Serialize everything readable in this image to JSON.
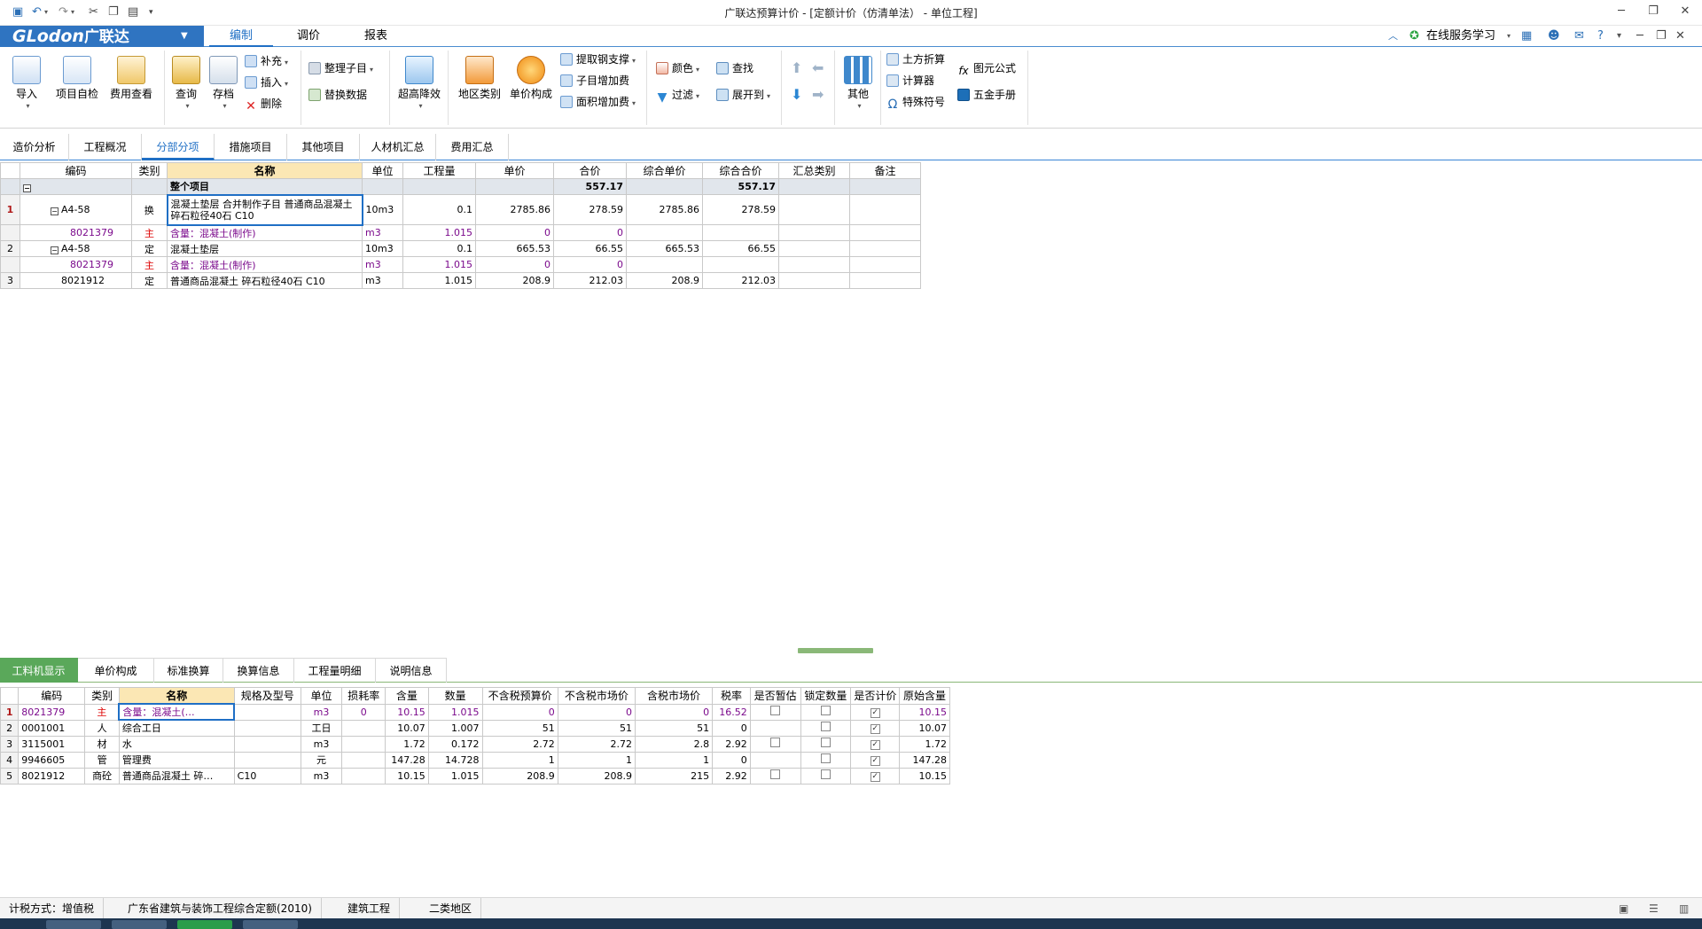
{
  "window": {
    "title": "广联达预算计价 - [定额计价（仿清单法） - 单位工程]"
  },
  "menu": {
    "logo_text": "GLodon",
    "logo_cn": "广联达",
    "tabs": [
      "编制",
      "调价",
      "报表"
    ],
    "online_learning": "在线服务学习"
  },
  "ribbon": {
    "import": "导入",
    "project_check": "项目自检",
    "fee_view": "费用查看",
    "query": "查询",
    "archive": "存档",
    "supplement": "补充",
    "insert": "插入",
    "delete": "删除",
    "organize_sub": "整理子目",
    "replace_data": "替换数据",
    "over_height": "超高降效",
    "region_type": "地区类别",
    "unit_price_comp": "单价构成",
    "extract_steel": "提取钢支撑",
    "sub_add_fee": "子目增加费",
    "area_add_fee": "面积增加费",
    "color": "颜色",
    "find": "查找",
    "filter": "过滤",
    "expand_to": "展开到",
    "other": "其他",
    "earth_convert": "土方折算",
    "calculator": "计算器",
    "special_symbol": "特殊符号",
    "formula": "图元公式",
    "hardware_manual": "五金手册"
  },
  "nav_tabs": [
    "造价分析",
    "工程概况",
    "分部分项",
    "措施项目",
    "其他项目",
    "人材机汇总",
    "费用汇总"
  ],
  "main_table": {
    "headers": [
      "编码",
      "类别",
      "名称",
      "单位",
      "工程量",
      "单价",
      "合价",
      "综合单价",
      "综合合价",
      "汇总类别",
      "备注"
    ],
    "summary": {
      "name": "整个项目",
      "total": "557.17",
      "comp_total": "557.17"
    },
    "rows": [
      {
        "num": "1",
        "code": "A4-58",
        "type": "换",
        "name": "混凝土垫层  合并制作子目 普通商品混凝土 碎石粒径40石 C10",
        "unit": "10m3",
        "qty": "0.1",
        "price": "2785.86",
        "total": "278.59",
        "comp_price": "2785.86",
        "comp_total": "278.59"
      },
      {
        "num": "",
        "code": "8021379",
        "type": "主",
        "name": "含量：混凝土(制作)",
        "unit": "m3",
        "qty": "1.015",
        "price": "0",
        "total": "0",
        "comp_price": "",
        "comp_total": ""
      },
      {
        "num": "2",
        "code": "A4-58",
        "type": "定",
        "name": "混凝土垫层",
        "unit": "10m3",
        "qty": "0.1",
        "price": "665.53",
        "total": "66.55",
        "comp_price": "665.53",
        "comp_total": "66.55"
      },
      {
        "num": "",
        "code": "8021379",
        "type": "主",
        "name": "含量：混凝土(制作)",
        "unit": "m3",
        "qty": "1.015",
        "price": "0",
        "total": "0",
        "comp_price": "",
        "comp_total": ""
      },
      {
        "num": "3",
        "code": "8021912",
        "type": "定",
        "name": "普通商品混凝土 碎石粒径40石 C10",
        "unit": "m3",
        "qty": "1.015",
        "price": "208.9",
        "total": "212.03",
        "comp_price": "208.9",
        "comp_total": "212.03"
      }
    ]
  },
  "bottom_tabs": [
    "工料机显示",
    "单价构成",
    "标准换算",
    "换算信息",
    "工程量明细",
    "说明信息"
  ],
  "bottom_table": {
    "headers": [
      "编码",
      "类别",
      "名称",
      "规格及型号",
      "单位",
      "损耗率",
      "含量",
      "数量",
      "不含税预算价",
      "不含税市场价",
      "含税市场价",
      "税率",
      "是否暂估",
      "锁定数量",
      "是否计价",
      "原始含量"
    ],
    "rows": [
      {
        "num": "1",
        "code": "8021379",
        "type": "主",
        "name": "含量：混凝土(…",
        "spec": "",
        "unit": "m3",
        "loss": "0",
        "content": "10.15",
        "qty": "1.015",
        "budget": "0",
        "market": "0",
        "tax_market": "0",
        "tax_rate": "16.52",
        "est": false,
        "lock": false,
        "priced": true,
        "orig": "10.15"
      },
      {
        "num": "2",
        "code": "0001001",
        "type": "人",
        "name": "综合工日",
        "spec": "",
        "unit": "工日",
        "loss": "",
        "content": "10.07",
        "qty": "1.007",
        "budget": "51",
        "market": "51",
        "tax_market": "51",
        "tax_rate": "0",
        "est": null,
        "lock": false,
        "priced": true,
        "orig": "10.07"
      },
      {
        "num": "3",
        "code": "3115001",
        "type": "材",
        "name": "水",
        "spec": "",
        "unit": "m3",
        "loss": "",
        "content": "1.72",
        "qty": "0.172",
        "budget": "2.72",
        "market": "2.72",
        "tax_market": "2.8",
        "tax_rate": "2.92",
        "est": false,
        "lock": false,
        "priced": true,
        "orig": "1.72"
      },
      {
        "num": "4",
        "code": "9946605",
        "type": "管",
        "name": "管理费",
        "spec": "",
        "unit": "元",
        "loss": "",
        "content": "147.28",
        "qty": "14.728",
        "budget": "1",
        "market": "1",
        "tax_market": "1",
        "tax_rate": "0",
        "est": null,
        "lock": false,
        "priced": true,
        "orig": "147.28"
      },
      {
        "num": "5",
        "code": "8021912",
        "type": "商砼",
        "name": "普通商品混凝土 碎…",
        "spec": "C10",
        "unit": "m3",
        "loss": "",
        "content": "10.15",
        "qty": "1.015",
        "budget": "208.9",
        "market": "208.9",
        "tax_market": "215",
        "tax_rate": "2.92",
        "est": false,
        "lock": false,
        "priced": true,
        "orig": "10.15"
      }
    ]
  },
  "status": {
    "tax_mode": "计税方式：增值税",
    "quota": "广东省建筑与装饰工程综合定额(2010)",
    "project_type": "建筑工程",
    "region": "二类地区"
  }
}
